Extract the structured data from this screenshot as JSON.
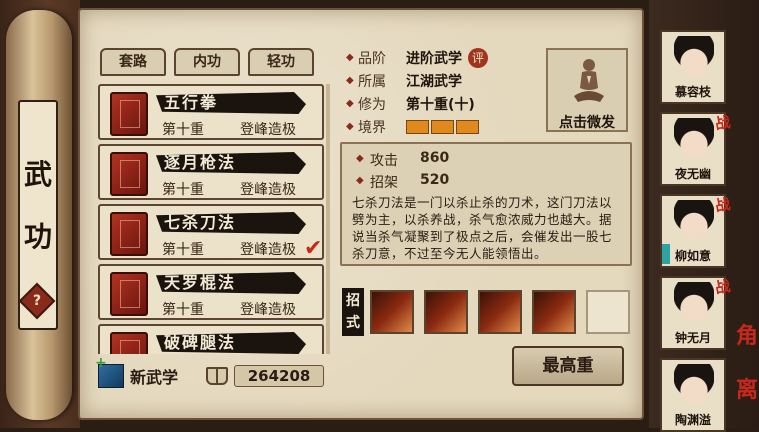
{
  "sidebar": {
    "title_chars": [
      "武",
      "功"
    ],
    "help_icon": "?"
  },
  "tabs": [
    {
      "label": "套路"
    },
    {
      "label": "内功"
    },
    {
      "label": "轻功"
    }
  ],
  "skills": [
    {
      "name": "五行拳",
      "level": "第十重",
      "rank": "登峰造极",
      "selected": false
    },
    {
      "name": "逐月枪法",
      "level": "第十重",
      "rank": "登峰造极",
      "selected": false
    },
    {
      "name": "七杀刀法",
      "level": "第十重",
      "rank": "登峰造极",
      "selected": true
    },
    {
      "name": "天罗棍法",
      "level": "第十重",
      "rank": "登峰造极",
      "selected": false
    },
    {
      "name": "破碑腿法",
      "level": "",
      "rank": "",
      "selected": false
    }
  ],
  "footer": {
    "new_skill_label": "新武学",
    "points": "264208"
  },
  "info": {
    "grade_label": "品阶",
    "grade_value": "进阶武学",
    "comment_badge": "评",
    "faction_label": "所属",
    "faction_value": "江湖武学",
    "cultivation_label": "修为",
    "cultivation_value": "第十重(十)",
    "realm_label": "境界",
    "realm_segments": 3
  },
  "meditate": {
    "label": "点击微发"
  },
  "stats": {
    "attack_label": "攻击",
    "attack_value": "860",
    "parry_label": "招架",
    "parry_value": "520",
    "description": "七杀刀法是一门以杀止杀的刀术，这门刀法以劈为主，以杀养战，杀气愈浓威力也越大。据说当杀气凝聚到了极点之后，会催发出一股七杀刀意，不过至今无人能领悟出。"
  },
  "moves": {
    "label": "招式",
    "slots": 5
  },
  "max_button": {
    "label": "最高重"
  },
  "roster": [
    {
      "name": "慕容枝",
      "battle": false
    },
    {
      "name": "夜无幽",
      "battle": true,
      "battle_label": "战"
    },
    {
      "name": "柳如意",
      "battle": true,
      "battle_label": "战"
    },
    {
      "name": "钟无月",
      "battle": true,
      "battle_label": "战"
    },
    {
      "name": "陶渊溢",
      "battle": false
    }
  ],
  "edge_text": [
    "角",
    "离"
  ],
  "colors": {
    "accent_red": "#c8281c",
    "realm_orange": "#e08a1e",
    "paper": "#e4d8bd"
  }
}
